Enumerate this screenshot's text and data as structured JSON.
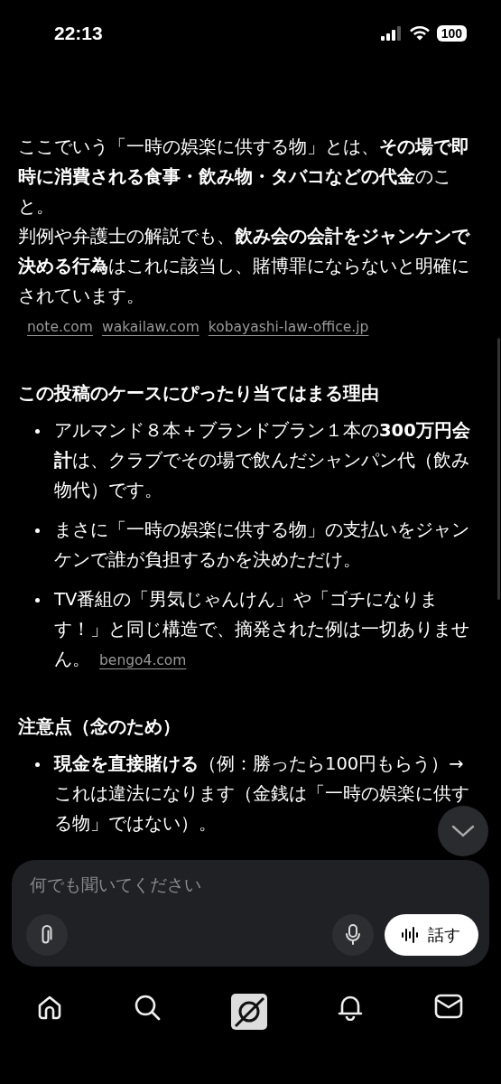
{
  "status_bar": {
    "time": "22:13",
    "battery": "100"
  },
  "intro": [
    {
      "text": "ここでいう「一時の娯楽に供する物」とは、**その場で即時に消費される食事・飲み物・タバコなどの代金**のこと。"
    },
    {
      "text": "判例や弁護士の解説でも、**飲み会の会計をジャンケンで決める行為**はこれに該当し、賭博罪にならないと明確にされています。",
      "sources": [
        "note.com",
        "wakailaw.com",
        "kobayashi-law-office.jp"
      ]
    }
  ],
  "sections": [
    {
      "heading": "この投稿のケースにぴったり当てはまる理由",
      "bullets": [
        {
          "text": "アルマンド８本＋ブランドブラン１本の**300万円会計**は、クラブでその場で飲んだシャンパン代（飲み物代）です。"
        },
        {
          "text": "まさに「一時の娯楽に供する物」の支払いをジャンケンで誰が負担するかを決めただけ。"
        },
        {
          "text": "TV番組の「男気じゃんけん」や「ゴチになります！」と同じ構造で、摘発された例は一切ありません。",
          "sources": [
            "bengo4.com"
          ]
        }
      ]
    },
    {
      "heading": "注意点（念のため）",
      "bullets": [
        {
          "text": "**現金を直接賭ける**（例：勝ったら100円もらう）→ これは違法になります（金銭は「一時の娯楽に供する物」ではない）。"
        }
      ]
    }
  ],
  "composer": {
    "placeholder": "何でも聞いてください",
    "talk_button": "話す"
  },
  "nav": [
    {
      "kind": "home"
    },
    {
      "kind": "search"
    },
    {
      "kind": "app"
    },
    {
      "kind": "bell"
    },
    {
      "kind": "mail"
    }
  ]
}
